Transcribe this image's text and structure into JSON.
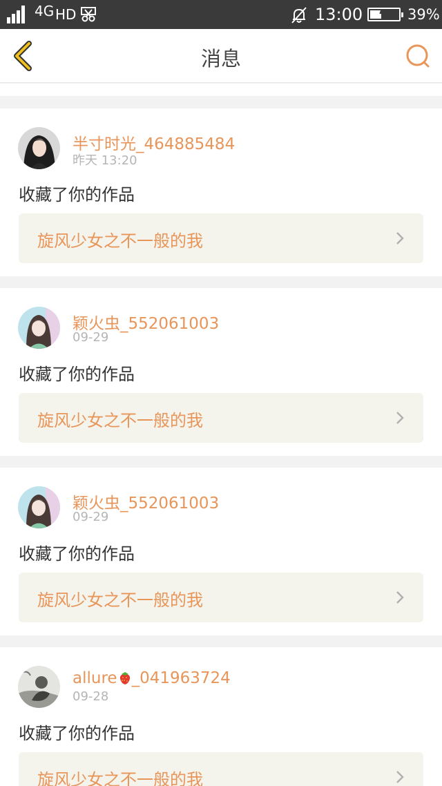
{
  "status_bar": {
    "network": "4G",
    "network_sub": "4↓",
    "hd": "HD",
    "time": "13:00",
    "battery_pct": "39%",
    "battery_level": 0.39
  },
  "nav": {
    "title": "消息",
    "back_icon": "chevron-left-icon",
    "search_icon": "search-icon",
    "accent_color": "#e8955a"
  },
  "messages": [
    {
      "user": "半寸时光_464885484",
      "time": "昨天 13:20",
      "action": "收藏了你的作品",
      "work": "旋风少女之不一般的我"
    },
    {
      "user": "颖火虫_552061003",
      "time": "09-29",
      "action": "收藏了你的作品",
      "work": "旋风少女之不一般的我"
    },
    {
      "user": "颖火虫_552061003",
      "time": "09-29",
      "action": "收藏了你的作品",
      "work": "旋风少女之不一般的我"
    },
    {
      "user_prefix": "allure",
      "user_suffix": "_041963724",
      "user_emoji": "strawberry-icon",
      "time": "09-28",
      "action": "收藏了你的作品",
      "work": "旋风少女之不一般的我"
    }
  ]
}
